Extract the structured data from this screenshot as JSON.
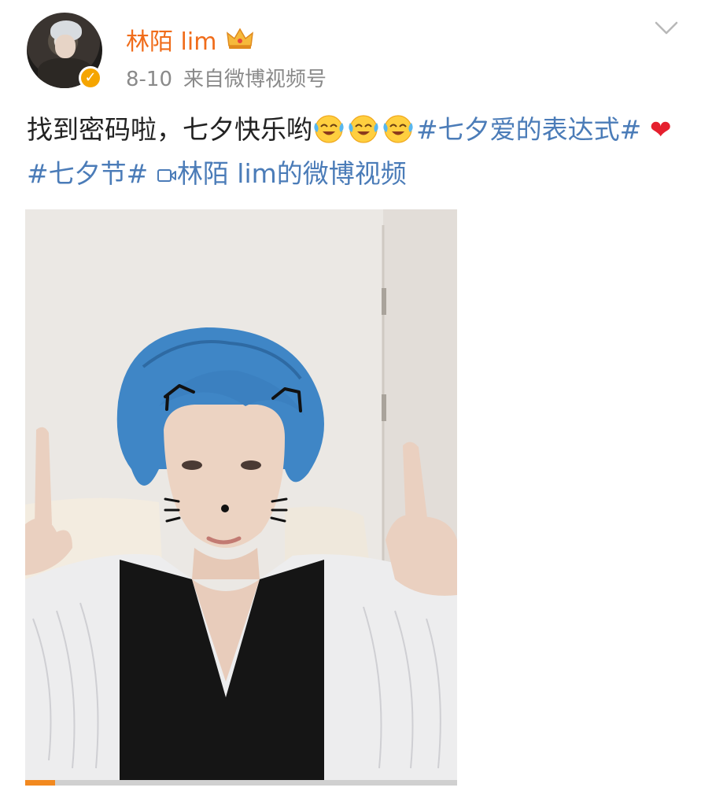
{
  "user": {
    "name": "林陌 lim",
    "badge_icon": "crown-icon",
    "verified_icon": "verified-check-icon",
    "verified_color": "#f5a500"
  },
  "meta": {
    "date": "8-10",
    "source": "来自微博视频号"
  },
  "post": {
    "text": "找到密码啦，七夕快乐哟",
    "emoji_icon": "laughing-crying-emoji-icon",
    "emoji_count": 3,
    "hashtag_1": "#七夕爱的表达式#",
    "heart": "❤",
    "hashtag_2": "#七夕节#",
    "video_link_icon": "video-camera-icon",
    "video_link": "林陌 lim的微博视频"
  },
  "video": {
    "progress": 0.07,
    "progress_color": "#f2891f"
  },
  "colors": {
    "username": "#f06c1a",
    "link": "#4b7cb8",
    "meta": "#8a8a8a"
  }
}
